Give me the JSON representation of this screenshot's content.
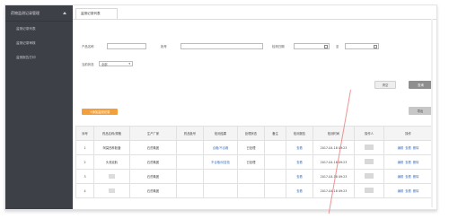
{
  "sidebar": {
    "header": "药物监测记录管理",
    "items": [
      {
        "label": "监测记录列表"
      },
      {
        "label": "监测记录审核"
      },
      {
        "label": "监测报告打印"
      }
    ]
  },
  "tab": {
    "label": "监测记录列表"
  },
  "filters": {
    "product_label": "产品名称",
    "product_placeholder": "",
    "batch_label": "批号",
    "date_label": "检测日期",
    "date_sep": "至",
    "status_label": "当前状态",
    "status_value": "全部"
  },
  "buttons": {
    "clear": "清空",
    "query": "查询",
    "add": "+添加监测记录",
    "export": "导出"
  },
  "table": {
    "headers": [
      "序号",
      "药品名称/规格",
      "生产厂家",
      "药品批号",
      "检测结果",
      "处理状态",
      "备注",
      "检测报告",
      "检测时间",
      "操作人",
      "操作"
    ],
    "rows": [
      {
        "no": "1",
        "name": "阿莫西林胶囊",
        "maker": "石药集团",
        "type": "",
        "result": "合格/不合格",
        "status": "已处理",
        "note": "",
        "report": "查看",
        "time": "2017-04-18 09:23",
        "ops": [
          "编辑",
          "查看",
          "删除"
        ]
      },
      {
        "no": "2",
        "name": "头孢克肟",
        "maker": "石药集团",
        "type": "",
        "result": "不合格/待复检",
        "status": "已处理",
        "note": "",
        "report": "查看",
        "time": "2017-04-18 09:23",
        "ops": [
          "编辑",
          "查看",
          "删除"
        ]
      },
      {
        "no": "3",
        "name": "",
        "maker": "石药集团",
        "type": "",
        "result": "",
        "status": "",
        "note": "",
        "report": "查看",
        "time": "2017-04-18 09:23",
        "ops": [
          "编辑",
          "查看",
          "删除"
        ]
      },
      {
        "no": "4",
        "name": "",
        "maker": "石药集团",
        "type": "",
        "result": "",
        "status": "",
        "note": "",
        "report": "查看",
        "time": "2017-04-18 09:23",
        "ops": [
          "编辑",
          "查看",
          "删除"
        ]
      }
    ]
  }
}
